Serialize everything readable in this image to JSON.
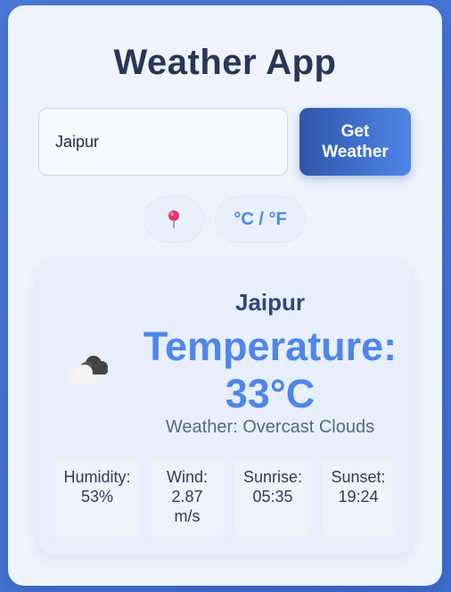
{
  "app": {
    "title": "Weather App"
  },
  "search": {
    "value": "Jaipur",
    "button_label": "Get\nWeather"
  },
  "controls": {
    "location_icon": "pin-icon",
    "unit_toggle_label": "°C / °F"
  },
  "weather": {
    "city": "Jaipur",
    "temperature_label": "Temperature:",
    "temperature_value": "33°C",
    "description": "Weather: Overcast Clouds",
    "icon": "overcast-clouds-icon",
    "details": [
      {
        "label": "Humidity:",
        "value": "53%"
      },
      {
        "label": "Wind:",
        "value": "2.87 m/s"
      },
      {
        "label": "Sunrise:",
        "value": "05:35"
      },
      {
        "label": "Sunset:",
        "value": "19:24"
      }
    ]
  },
  "colors": {
    "accent": "#4f86e8",
    "button_dark": "#2f56a8",
    "title": "#2a3654"
  }
}
